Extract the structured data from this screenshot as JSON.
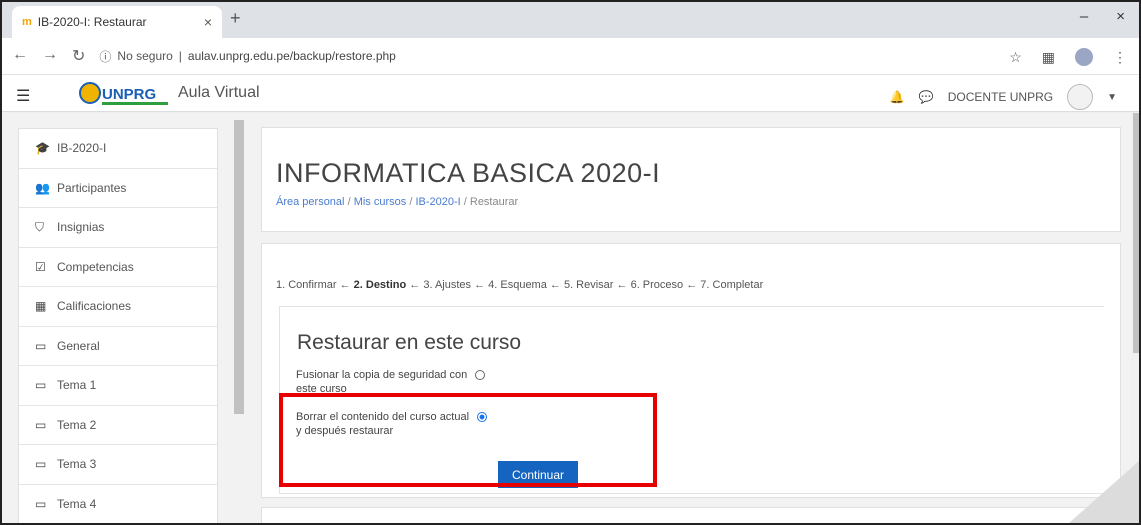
{
  "browser": {
    "tab_title": "IB-2020-I: Restaurar",
    "tab_close": "×",
    "new_tab": "+",
    "window_min": "–",
    "window_close": "×",
    "not_secure": "No seguro",
    "url": "aulav.unprg.edu.pe/backup/restore.php"
  },
  "navbar": {
    "menu_icon": "☰",
    "brand": "Aula Virtual",
    "user_name": "DOCENTE UNPRG"
  },
  "sidebar": {
    "items": [
      {
        "icon": "graduation-cap-icon",
        "label": "IB-2020-I"
      },
      {
        "icon": "users-icon",
        "label": "Participantes"
      },
      {
        "icon": "shield-icon",
        "label": "Insignias"
      },
      {
        "icon": "checkbox-icon",
        "label": "Competencias"
      },
      {
        "icon": "table-icon",
        "label": "Calificaciones"
      },
      {
        "icon": "folder-icon",
        "label": "General"
      },
      {
        "icon": "folder-icon",
        "label": "Tema 1"
      },
      {
        "icon": "folder-icon",
        "label": "Tema 2"
      },
      {
        "icon": "folder-icon",
        "label": "Tema 3"
      },
      {
        "icon": "folder-icon",
        "label": "Tema 4"
      }
    ]
  },
  "header": {
    "title": "INFORMATICA BASICA 2020-I",
    "breadcrumb": [
      "Área personal",
      "Mis cursos",
      "IB-2020-I",
      "Restaurar"
    ],
    "sep": "/"
  },
  "restore": {
    "steps_prefix": "1. Confirmar ← ",
    "step_current": "2. Destino",
    "steps_suffix": " ← 3. Ajustes ← 4. Esquema ← 5. Revisar ← 6. Proceso ← 7. Completar",
    "section_title": "Restaurar en este curso",
    "option1_line1": "Fusionar la copia de seguridad con",
    "option1_line2": "este curso",
    "option2_line1": "Borrar el contenido del curso actual",
    "option2_line2": "y después restaurar",
    "continue_label": "Continuar"
  },
  "colors": {
    "accent": "#1565c0",
    "highlight": "#e60000"
  }
}
